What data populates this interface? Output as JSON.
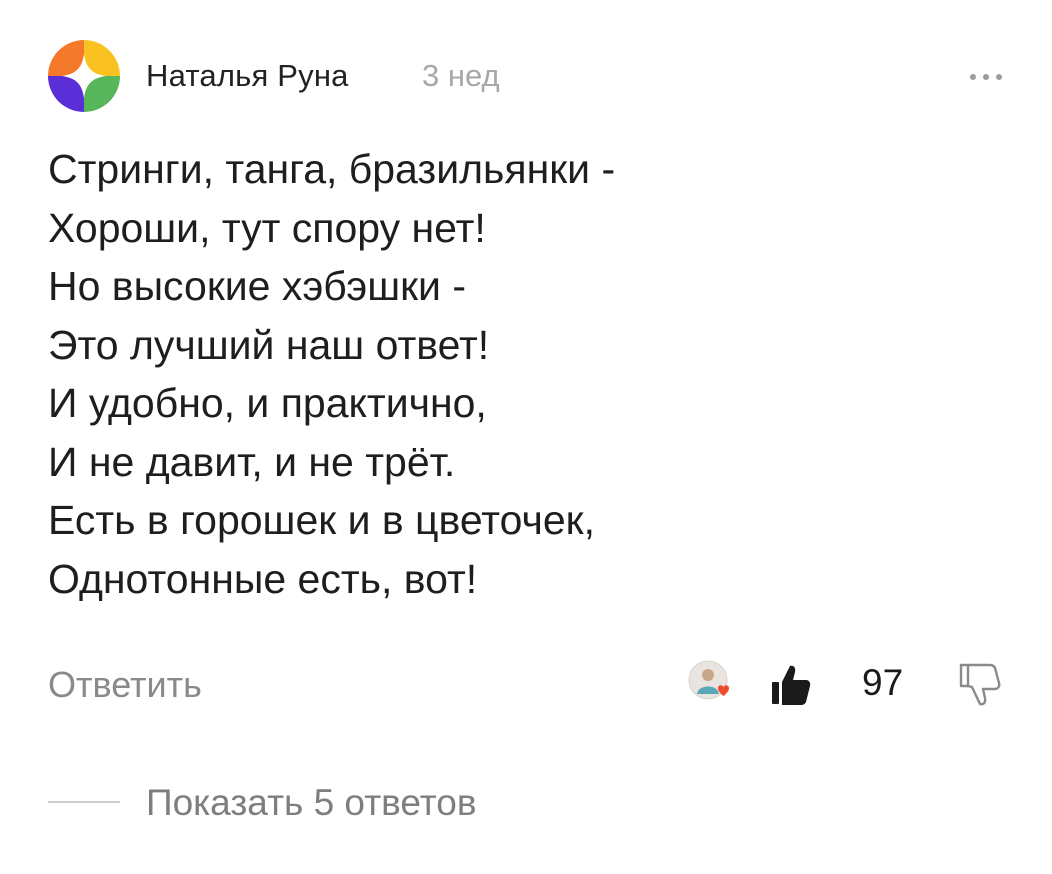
{
  "comment": {
    "author": "Наталья Руна",
    "time": "3 нед",
    "avatar_icon": "multicolor-star-avatar",
    "more_icon": "more-dots-icon",
    "lines": [
      "Стринги, танга, бразильянки -",
      "Хороши, тут спору нет!",
      "Но высокие хэбэшки -",
      "Это лучший наш ответ!",
      "И удобно, и практично,",
      "И не давит, и не трёт.",
      "Есть в горошек и в цветочек,",
      "Однотонные есть, вот!"
    ]
  },
  "actions": {
    "reply_label": "Ответить",
    "liker_avatar_icon": "liker-avatar-with-heart",
    "like_icon": "thumbs-up-icon",
    "like_count": "97",
    "dislike_icon": "thumbs-down-icon"
  },
  "replies": {
    "show_label": "Показать 5 ответов"
  },
  "colors": {
    "avatar_orange": "#F5792A",
    "avatar_yellow": "#F9C221",
    "avatar_purple": "#5A2FD8",
    "avatar_green": "#58B65A",
    "text_primary": "#1e1e1e",
    "text_muted": "#8a8a8a",
    "heart": "#F04A2D"
  }
}
